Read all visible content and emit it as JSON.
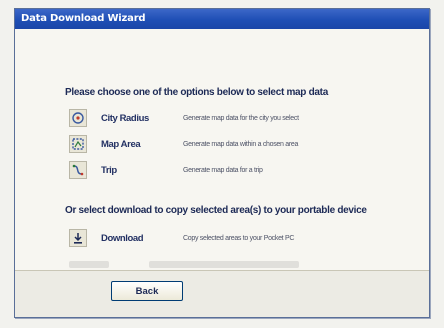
{
  "window": {
    "title": "Data Download Wizard"
  },
  "prompts": {
    "select": "Please choose one of the options below to select map data",
    "download": "Or select download to copy selected area(s) to your portable device"
  },
  "options": [
    {
      "label": "City Radius",
      "description": "Generate map data for the city you select",
      "icon": "city-radius-icon"
    },
    {
      "label": "Map Area",
      "description": "Generate map data within a chosen area",
      "icon": "map-area-icon"
    },
    {
      "label": "Trip",
      "description": "Generate map data for a trip",
      "icon": "trip-icon"
    }
  ],
  "download": {
    "label": "Download",
    "description": "Copy selected areas to your Pocket PC",
    "icon": "download-icon"
  },
  "buttons": {
    "back": "Back"
  }
}
